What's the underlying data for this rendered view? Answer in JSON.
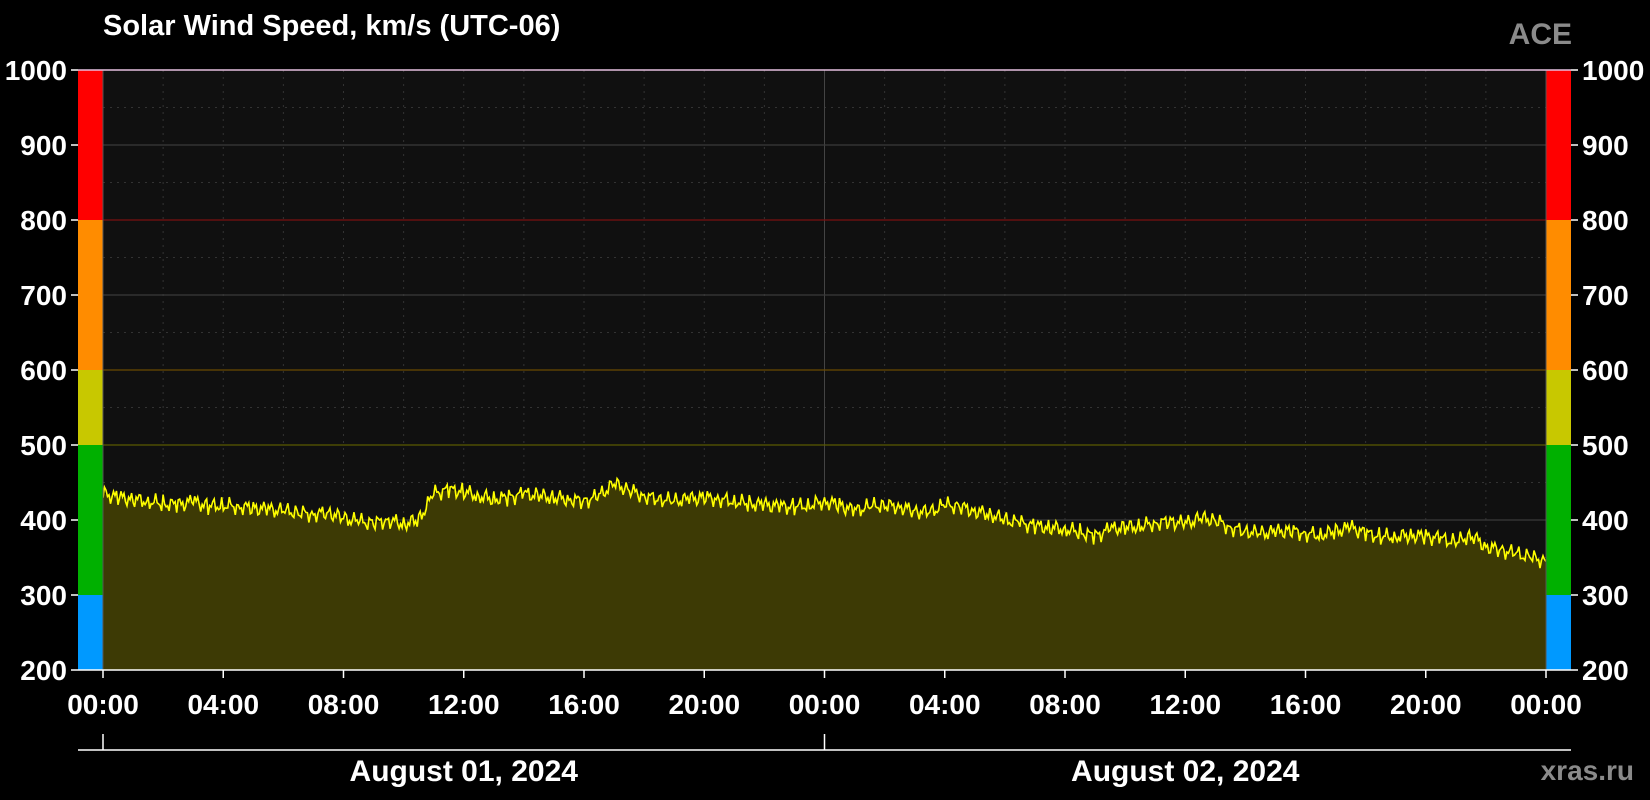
{
  "header": {
    "title": "Solar Wind Speed, km/s (UTC-06)",
    "source": "ACE",
    "credit": "xras.ru"
  },
  "chart_data": {
    "type": "area",
    "title": "Solar Wind Speed, km/s (UTC-06)",
    "xlabel": "",
    "ylabel": "",
    "ylim": [
      200,
      1000
    ],
    "xlim_hours": [
      0,
      48
    ],
    "y_ticks": [
      200,
      300,
      400,
      500,
      600,
      700,
      800,
      900,
      1000
    ],
    "x_tick_labels": [
      "00:00",
      "04:00",
      "08:00",
      "12:00",
      "16:00",
      "20:00",
      "00:00",
      "04:00",
      "08:00",
      "12:00",
      "16:00",
      "20:00",
      "00:00"
    ],
    "dates": [
      {
        "label": "August 01, 2024",
        "start_hour": 0,
        "end_hour": 24
      },
      {
        "label": "August 02, 2024",
        "start_hour": 24,
        "end_hour": 48
      }
    ],
    "thresholds": [
      {
        "from": 200,
        "to": 300,
        "color": "#0099ff"
      },
      {
        "from": 300,
        "to": 500,
        "color": "#00b000"
      },
      {
        "from": 500,
        "to": 600,
        "color": "#c8c800"
      },
      {
        "from": 600,
        "to": 800,
        "color": "#ff8c00"
      },
      {
        "from": 800,
        "to": 1000,
        "color": "#ff0000"
      }
    ],
    "grid": true,
    "series": [
      {
        "line_color": "#ffff00",
        "fill_color": "#3d3a05",
        "x_hours": [
          0,
          0.5,
          1,
          1.5,
          2,
          2.5,
          3,
          3.5,
          4,
          4.5,
          5,
          5.5,
          6,
          6.5,
          7,
          7.5,
          8,
          8.5,
          9,
          9.5,
          10,
          10.5,
          11,
          11.5,
          12,
          12.5,
          13,
          13.5,
          14,
          14.5,
          15,
          15.5,
          16,
          16.5,
          17,
          17.5,
          18,
          18.5,
          19,
          19.5,
          20,
          20.5,
          21,
          21.5,
          22,
          22.5,
          23,
          23.5,
          24,
          24.5,
          25,
          25.5,
          26,
          26.5,
          27,
          27.5,
          28,
          28.5,
          29,
          29.5,
          30,
          30.5,
          31,
          31.5,
          32,
          32.5,
          33,
          33.5,
          34,
          34.5,
          35,
          35.5,
          36,
          36.5,
          37,
          37.5,
          38,
          38.5,
          39,
          39.5,
          40,
          40.5,
          41,
          41.5,
          42,
          42.5,
          43,
          43.5,
          44,
          44.5,
          45,
          45.5,
          46,
          46.5,
          47,
          47.5,
          48
        ],
        "values": [
          435,
          430,
          428,
          425,
          422,
          420,
          425,
          418,
          420,
          418,
          416,
          414,
          412,
          410,
          408,
          410,
          402,
          398,
          396,
          400,
          395,
          400,
          435,
          440,
          438,
          432,
          428,
          430,
          435,
          432,
          430,
          428,
          425,
          432,
          448,
          440,
          432,
          428,
          425,
          428,
          430,
          428,
          425,
          422,
          420,
          418,
          418,
          420,
          425,
          420,
          412,
          418,
          420,
          418,
          412,
          410,
          420,
          418,
          412,
          408,
          400,
          396,
          392,
          390,
          388,
          384,
          378,
          388,
          390,
          392,
          396,
          398,
          395,
          402,
          400,
          390,
          385,
          382,
          384,
          386,
          382,
          380,
          385,
          390,
          382,
          378,
          378,
          380,
          378,
          375,
          370,
          380,
          365,
          360,
          355,
          350,
          345,
          340,
          338
        ]
      }
    ]
  }
}
